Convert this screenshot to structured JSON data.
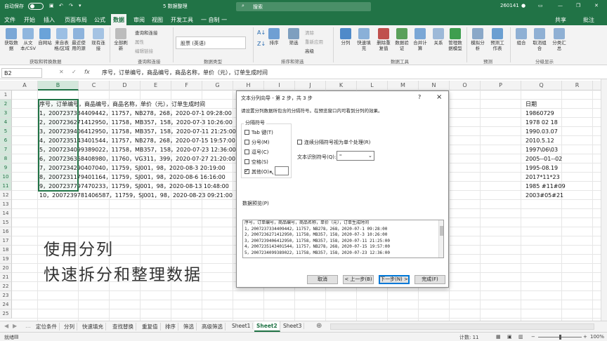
{
  "titlebar": {
    "autosave": "自动保存",
    "toggle": "关",
    "filename": "5 数据整理",
    "search": "搜索",
    "user": "260141"
  },
  "menu": [
    "文件",
    "开始",
    "插入",
    "页面布局",
    "公式",
    "数据",
    "审阅",
    "视图",
    "开发工具",
    "一 自制 一"
  ],
  "menu_right": {
    "share": "共享",
    "comment": "批注"
  },
  "ribbon": {
    "get_data": "获取数据",
    "from_csv": "从文本/CSV",
    "from_web": "自网站",
    "from_table": "来自表格/区域",
    "recent": "最近使用的源",
    "existing": "现有连接",
    "refresh_all": "全部刷新",
    "queries": "查询和连接",
    "properties": "属性",
    "edit_links": "编辑链接",
    "stocks": "股票 (英语)",
    "sort": "排序",
    "filter": "筛选",
    "clear": "清除",
    "reapply": "重新应用",
    "advanced": "高级",
    "split": "分列",
    "flash_fill": "快速填充",
    "remove_dup": "删除重复值",
    "validation": "数据验证",
    "consolidate": "合并计算",
    "relations": "关系",
    "data_model": "管理数据模型",
    "what_if": "模拟分析",
    "forecast_sheet": "预测工作表",
    "group": "组合",
    "ungroup": "取消组合",
    "subtotal": "分类汇总",
    "groups": [
      "获取和转换数据",
      "查询和连接",
      "数据类型",
      "排序和筛选",
      "数据工具",
      "预测",
      "分级显示"
    ]
  },
  "formula_bar": {
    "name_box": "B2",
    "fx": "fx",
    "content": "序号，订单编号，商品编号，商品名称，单价（元），订单生成时间"
  },
  "columns": [
    "A",
    "B",
    "C",
    "D",
    "E",
    "F",
    "G",
    "H",
    "I",
    "J",
    "K",
    "L",
    "M",
    "N",
    "O",
    "P",
    "Q",
    "R",
    "S",
    "T"
  ],
  "rows": [
    "1",
    "2",
    "3",
    "4",
    "5",
    "6",
    "7",
    "8",
    "9",
    "10",
    "11",
    "12",
    "13",
    "14",
    "15",
    "16",
    "17",
    "18",
    "19",
    "20",
    "21",
    "22",
    "23",
    "24",
    "25"
  ],
  "column_b": [
    "序号，订单编号，商品编号，商品名称，单价（元），订单生成时间",
    "1，200723733440944​2，11757，NB278，268，2020-07-1 09:28:00",
    "2，200723627141295​0，11758，MB357，158，2020-07-3 10:26:00",
    "3，200723940641295​0，11758，MB357，158，2020-07-11 21:25:00",
    "4，200723514340154​4，11757，NB278，268，2020-07-15 19:57:00",
    "5，200723409938902​2，11758，MB357，158，2020-07-23 12:36:00",
    "6，200723636840898​0，11760，VG311，399，2020-07-27 21:20:00",
    "7，200723429040704​0，11759，SJ001，98，2020-08-3 20:19:00",
    "8，200723117940116​4，11759，SJ001，98，2020-08-6 16:16:00",
    "9，200723779747023​3，11759，SJ001，98，2020-08-13 10:48:00",
    "10，200723978140658​7，11759，SJ001，98，2020-08-23 09:21:00"
  ],
  "column_q": [
    "日期",
    "19860729",
    "1978 02 18",
    "1990.03.07",
    "2010.5.12",
    "1997\\06\\03",
    "2005--01--02",
    "1995-08.19",
    "2017*11*23",
    "1985 #11#09",
    "2003#05#21"
  ],
  "caption": [
    "使用分列",
    "快速拆分和整理数据"
  ],
  "dialog": {
    "title": "文本分列向导 - 第 2 步，共 3 步",
    "help": "?",
    "close": "×",
    "desc": "请设置分列数据所包含的分隔符号。在预览窗口内可看到分列的效果。",
    "delim_label": "分隔符号",
    "delims": [
      {
        "label": "Tab 键(T)",
        "checked": false
      },
      {
        "label": "分号(M)",
        "checked": false
      },
      {
        "label": "逗号(C)",
        "checked": false
      },
      {
        "label": "空格(S)",
        "checked": false
      },
      {
        "label": "其他(O):",
        "checked": true
      }
    ],
    "other_value": "",
    "consecutive": "连续分隔符号视为单个处理(R)",
    "qualifier_label": "文本识别符号(Q):",
    "qualifier_value": "\"",
    "preview_label": "数据预览(P)",
    "preview": [
      "序号，订单编号，商品编号，商品名称，单价（元），订单生成时间",
      "1，200723733440944​2，11757，NB278，268，2020-07-1 09:28:00",
      "2，200723627141295​0，11758，MB357，158，2020-07-3 10:26:00",
      "3，200723940641295​0，11758，MB357，158，2020-07-11 21:25:00",
      "4，200723514340154​4，11757，NB278，268，2020-07-15 19:57:00",
      "5，200723409938902​2，11758，MB357，158，2020-07-23 12:36:00"
    ],
    "cancel": "取消",
    "back": "< 上一步(B)",
    "next": "下一步(N) >",
    "finish": "完成(F)"
  },
  "sheet_tabs": [
    "定位条件",
    "分列",
    "快速填充",
    "查找替换",
    "重复值",
    "排序",
    "筛选",
    "高级筛选",
    "Sheet1",
    "Sheet2",
    "Sheet3"
  ],
  "active_tab": "Sheet2",
  "add_sheet": "⊕",
  "status": {
    "ready": "就绪",
    "count": "计数: 11",
    "zoom": "100%"
  }
}
